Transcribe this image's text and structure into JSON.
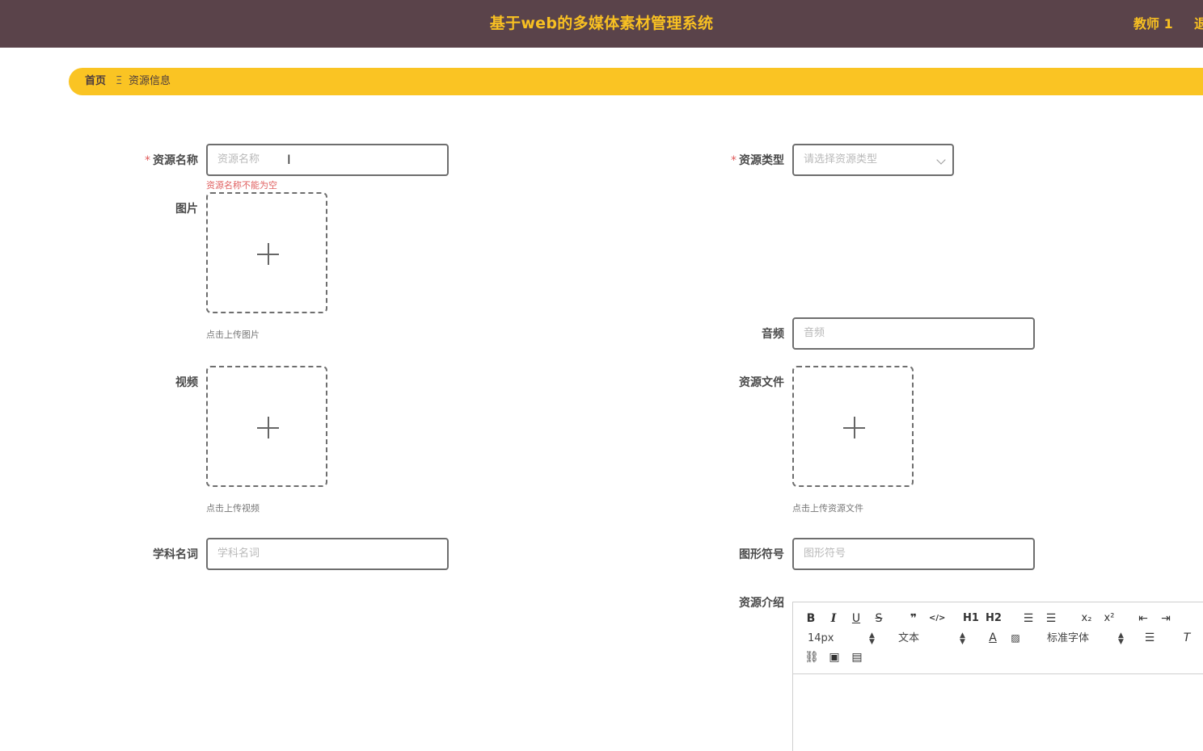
{
  "header": {
    "title": "基于web的多媒体素材管理系统",
    "user": "教师 1",
    "logout": "退"
  },
  "breadcrumb": {
    "home": "首页",
    "separator": "Ξ",
    "current": "资源信息"
  },
  "form": {
    "name": {
      "label": "资源名称",
      "placeholder": "资源名称",
      "error": "资源名称不能为空",
      "required": "*"
    },
    "type": {
      "label": "资源类型",
      "placeholder": "请选择资源类型",
      "required": "*"
    },
    "image": {
      "label": "图片",
      "tip": "点击上传图片"
    },
    "audio": {
      "label": "音频",
      "placeholder": "音频"
    },
    "video": {
      "label": "视频",
      "tip": "点击上传视频"
    },
    "file": {
      "label": "资源文件",
      "tip": "点击上传资源文件"
    },
    "subject": {
      "label": "学科名词",
      "placeholder": "学科名词"
    },
    "symbol": {
      "label": "图形符号",
      "placeholder": "图形符号"
    },
    "intro": {
      "label": "资源介绍"
    }
  },
  "editor": {
    "font_size": "14px",
    "format": "文本",
    "font_family": "标准字体",
    "buttons": [
      "B",
      "I",
      "U",
      "S",
      "99",
      "</>",
      "H1",
      "H2",
      "ol",
      "ul",
      "X2",
      "X2",
      "outdent",
      "indent"
    ]
  },
  "colors": {
    "header_bg": "#5a434a",
    "accent": "#f8c022",
    "breadcrumb_bg": "#fac423",
    "error": "#e05a5a"
  }
}
